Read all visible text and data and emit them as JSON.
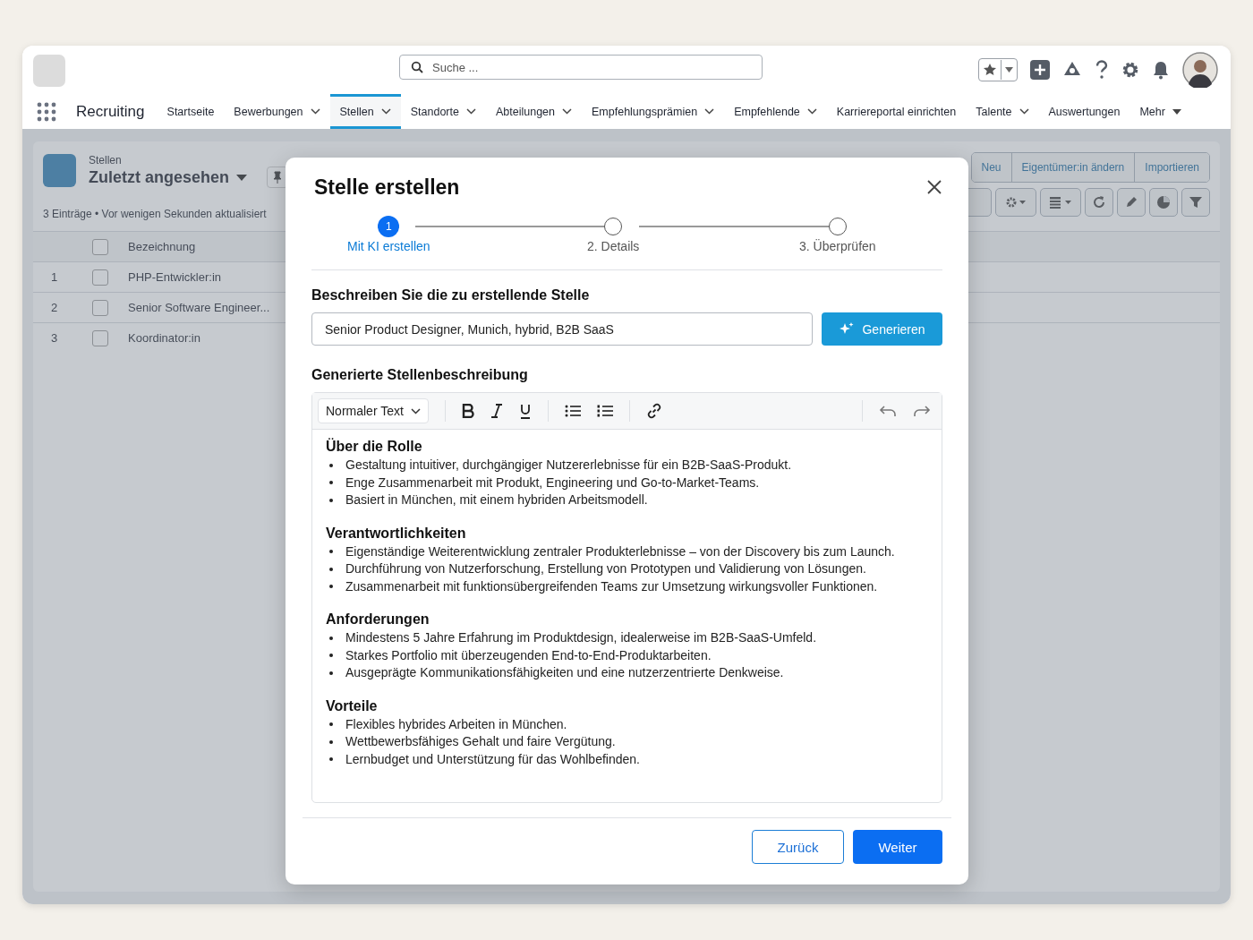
{
  "app": {
    "name": "Recruiting"
  },
  "search": {
    "placeholder": "Suche ..."
  },
  "nav_tabs": [
    {
      "label": "Startseite",
      "kind": "link",
      "selected": false
    },
    {
      "label": "Bewerbungen",
      "kind": "dropdown",
      "selected": false
    },
    {
      "label": "Stellen",
      "kind": "dropdown",
      "selected": true
    },
    {
      "label": "Standorte",
      "kind": "dropdown",
      "selected": false
    },
    {
      "label": "Abteilungen",
      "kind": "dropdown",
      "selected": false
    },
    {
      "label": "Empfehlungsprämien",
      "kind": "dropdown",
      "selected": false
    },
    {
      "label": "Empfehlende",
      "kind": "dropdown",
      "selected": false
    },
    {
      "label": "Karriereportal einrichten",
      "kind": "link",
      "selected": false
    },
    {
      "label": "Talente",
      "kind": "dropdown",
      "selected": false
    },
    {
      "label": "Auswertungen",
      "kind": "link",
      "selected": false
    },
    {
      "label": "Mehr",
      "kind": "more",
      "selected": false
    }
  ],
  "list_view": {
    "object": "Stellen",
    "title": "Zuletzt angesehen",
    "status": "3 Einträge • Vor wenigen Sekunden aktualisiert",
    "column": "Bezeichnung",
    "all_checked": false,
    "rows": [
      {
        "number": "1",
        "name": "PHP-Entwickler:in",
        "checked": false
      },
      {
        "number": "2",
        "name": "Senior Software Engineer...",
        "checked": false
      },
      {
        "number": "3",
        "name": "Koordinator:in",
        "checked": false
      }
    ]
  },
  "action_buttons": [
    "Neu",
    "Eigentümer:in ändern",
    "Importieren"
  ],
  "dialog": {
    "title": "Stelle erstellen",
    "steps": [
      {
        "marker": "1",
        "label": "Mit KI erstellen",
        "selected": true
      },
      {
        "label": "2. Details",
        "selected": false
      },
      {
        "label": "3. Überprüfen",
        "selected": false
      }
    ],
    "prompt_label": "Beschreiben Sie die zu erstellende Stelle",
    "prompt_value": "Senior Product Designer, Munich, hybrid, B2B SaaS",
    "generate_button": "Generieren",
    "description_label": "Generierte Stellenbeschreibung",
    "editor": {
      "format": "Normaler Text",
      "sections": [
        {
          "heading": "Über die Rolle",
          "items": [
            "Gestaltung intuitiver, durchgängiger Nutzererlebnisse für ein B2B-SaaS-Produkt.",
            "Enge Zusammenarbeit mit Produkt, Engineering und Go-to-Market-Teams.",
            "Basiert in München, mit einem hybriden Arbeitsmodell."
          ]
        },
        {
          "heading": "Verantwortlichkeiten",
          "items": [
            "Eigenständige Weiterentwicklung zentraler Produkterlebnisse – von der Discovery bis zum Launch.",
            "Durchführung von Nutzerforschung, Erstellung von Prototypen und Validierung von Lösungen.",
            "Zusammenarbeit mit funktionsübergreifenden Teams zur Umsetzung wirkungsvoller Funktionen."
          ]
        },
        {
          "heading": "Anforderungen",
          "items": [
            "Mindestens 5 Jahre Erfahrung im Produktdesign, idealerweise im B2B-SaaS-Umfeld.",
            "Starkes Portfolio mit überzeugenden End-to-End-Produktarbeiten.",
            "Ausgeprägte Kommunikationsfähigkeiten und eine nutzerzentrierte Denkweise."
          ]
        },
        {
          "heading": "Vorteile",
          "items": [
            "Flexibles hybrides Arbeiten in München.",
            "Wettbewerbsfähiges Gehalt und faire Vergütung.",
            "Lernbudget und Unterstützung für das Wohlbefinden."
          ]
        }
      ]
    },
    "buttons": [
      {
        "label": "Zurück",
        "kind": "secondary"
      },
      {
        "label": "Weiter",
        "kind": "primary"
      }
    ]
  }
}
